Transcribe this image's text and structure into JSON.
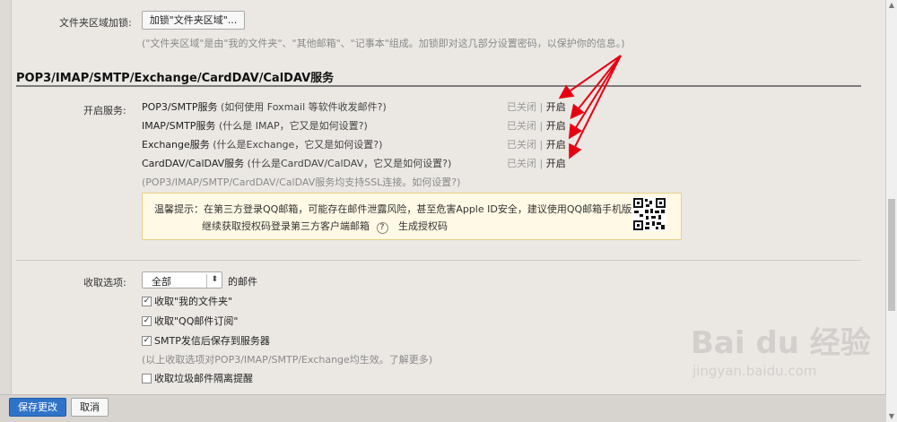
{
  "folder_lock": {
    "label": "文件夹区域加锁:",
    "button": "加锁\"文件夹区域\"...",
    "hint": "(\"文件夹区域\"是由\"我的文件夹\"、\"其他邮箱\"、\"记事本\"组成。加锁即对这几部分设置密码，以保护你的信息。)"
  },
  "section_title": "POP3/IMAP/SMTP/Exchange/CardDAV/CalDAV服务",
  "services": {
    "label": "开启服务:",
    "items": [
      {
        "name": "POP3/SMTP服务",
        "desc": "(如何使用 Foxmail 等软件收发邮件?)",
        "closed": "已关闭",
        "sep": "|",
        "open": "开启"
      },
      {
        "name": "IMAP/SMTP服务",
        "desc": "(什么是 IMAP，它又是如何设置?)",
        "closed": "已关闭",
        "sep": "|",
        "open": "开启"
      },
      {
        "name": "Exchange服务",
        "desc": "(什么是Exchange，它又是如何设置?)",
        "closed": "已关闭",
        "sep": "|",
        "open": "开启"
      },
      {
        "name": "CardDAV/CalDAV服务",
        "desc": "(什么是CardDAV/CalDAV，它又是如何设置?)",
        "closed": "已关闭",
        "sep": "|",
        "open": "开启"
      }
    ],
    "ssl_hint": "(POP3/IMAP/SMTP/CardDAV/CalDAV服务均支持SSL连接。如何设置?)"
  },
  "notice": {
    "line1": "温馨提示：在第三方登录QQ邮箱，可能存在邮件泄露风险，甚至危害Apple ID安全，建议使用QQ邮箱手机版登录。",
    "line2_a": "继续获取授权码登录第三方客户端邮箱",
    "help_icon": "?",
    "line2_b": "生成授权码"
  },
  "receive": {
    "label": "收取选项:",
    "select_value": "全部",
    "select_suffix": "的邮件",
    "options": [
      {
        "label": "收取\"我的文件夹\"",
        "checked": true
      },
      {
        "label": "收取\"QQ邮件订阅\"",
        "checked": true
      },
      {
        "label": "SMTP发信后保存到服务器",
        "checked": true
      }
    ],
    "options_hint": "(以上收取选项对POP3/IMAP/SMTP/Exchange均生效。了解更多)",
    "spam_label": "收取垃圾邮件隔离提醒",
    "spam_checked": false
  },
  "footer": {
    "save": "保存更改",
    "cancel": "取消"
  },
  "watermark": {
    "brand": "Bai du 经验",
    "url": "jingyan.baidu.com"
  },
  "colors": {
    "arrow": "#e60012",
    "primary_button": "#2f73c9",
    "notice_bg": "#fff9e5"
  }
}
